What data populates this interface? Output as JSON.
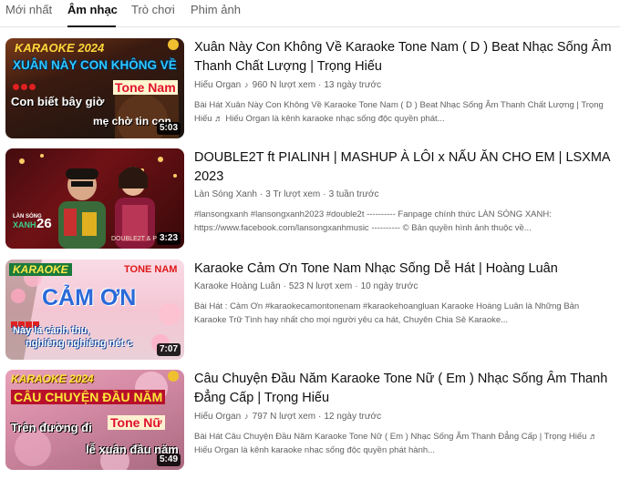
{
  "tabs": [
    {
      "label": "Mới nhất"
    },
    {
      "label": "Âm nhạc"
    },
    {
      "label": "Trò chơi"
    },
    {
      "label": "Phim ảnh"
    }
  ],
  "active_tab": "Âm nhạc",
  "videos": [
    {
      "title": "Xuân Này Con Không Về Karaoke Tone Nam ( D ) Beat Nhạc Sống Âm Thanh Chất Lượng | Trọng Hiếu",
      "channel": "Hiếu Organ",
      "channel_icon": "music-note-icon",
      "views": "960 N lượt xem",
      "age": "13 ngày trước",
      "description": "Bài Hát Xuân Này Con Không Về Karaoke Tone Nam ( D ) Beat Nhạc Sống Âm Thanh Chất Lượng | Trọng Hiếu ♬ Hiếu Organ là kênh karaoke nhạc sống độc quyền phát...",
      "duration": "5:03",
      "thumb_text": {
        "badge": "KARAOKE 2024",
        "headline": "XUÂN NÀY CON KHÔNG VỀ",
        "tone": "Tone Nam",
        "lyric1": "Con biết bây giờ",
        "lyric2": "mẹ chờ tin con"
      }
    },
    {
      "title": "DOUBLE2T ft PIALINH | MASHUP À LÔI x NẤU ĂN CHO EM | LSXMA 2023",
      "channel": "Làn Sóng Xanh",
      "views": "3 Tr lượt xem",
      "age": "3 tuần trước",
      "description": "#lansongxanh #lansongxanh2023 #double2t ---------- Fanpage chính thức LÀN SÓNG XANH: https://www.facebook.com/lansongxanhmusic ---------- © Bản quyền hình ảnh thuộc về...",
      "duration": "3:23",
      "thumb_text": {
        "logo_top": "LÀN SÓNG",
        "logo_mid": "XANH",
        "logo_num": "26",
        "caption": "DOUBLE2T & P"
      }
    },
    {
      "title": "Karaoke Cảm Ơn Tone Nam Nhạc Sống Dễ Hát | Hoàng Luân",
      "channel": "Karaoke Hoàng Luân",
      "views": "523 N lượt xem",
      "age": "10 ngày trước",
      "description": "Bài Hát : Cảm Ơn #karaokecamontonenam #karaokehoangluan Karaoke Hoàng Luân là Những Bản Karaoke Trữ Tình hay nhất cho mọi người yêu ca hát, Chuyên Chia Sẻ Karaoke...",
      "duration": "7:07",
      "thumb_text": {
        "badge": "KARAOKE",
        "tone": "TONE NAM",
        "headline": "CẢM ƠN",
        "lyric1": "Này lá cành thu,",
        "lyric2": "nghiêng nghiêng nét c"
      }
    },
    {
      "title": "Câu Chuyện Đầu Năm Karaoke Tone Nữ ( Em ) Nhạc Sống Âm Thanh Đẳng Cấp | Trọng Hiếu",
      "channel": "Hiếu Organ",
      "channel_icon": "music-note-icon",
      "views": "797 N lượt xem",
      "age": "12 ngày trước",
      "description": "Bài Hát Câu Chuyện Đầu Năm Karaoke Tone Nữ ( Em ) Nhạc Sống Âm Thanh Đẳng Cấp | Trọng Hiếu ♬ Hiếu Organ là kênh karaoke nhạc sống độc quyền phát hành...",
      "duration": "5:49",
      "thumb_text": {
        "badge": "KARAOKE 2024",
        "headline": "CÂU CHUYỆN ĐẦU NĂM",
        "tone": "Tone Nữ",
        "lyric1": "Trên đường đi",
        "lyric2": "lễ xuân đầu năm"
      }
    }
  ],
  "colors": {
    "title_text": "#0f0f0f",
    "meta_text": "#606060",
    "divider": "#e5e5e5",
    "duration_bg": "#000000"
  }
}
